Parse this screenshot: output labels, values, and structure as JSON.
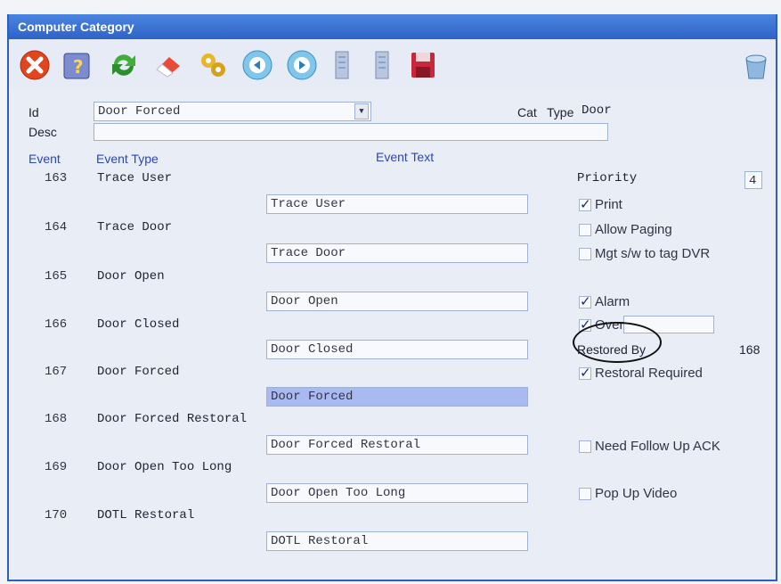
{
  "window": {
    "title": "Computer Category"
  },
  "toolbar": {
    "icons": [
      "close-icon",
      "help-icon",
      "refresh-icon",
      "eraser-icon",
      "gear-users-icon",
      "previous-icon",
      "next-icon",
      "document-icon",
      "document-alt-icon",
      "save-icon",
      "bucket-icon"
    ]
  },
  "form": {
    "id_label": "Id",
    "id_value": "Door Forced",
    "desc_label": "Desc",
    "desc_value": "",
    "cat_label": "Cat",
    "type_label": "Type",
    "type_value": "Door"
  },
  "columns": {
    "event": "Event",
    "event_type": "Event Type",
    "event_text": "Event Text"
  },
  "events": [
    {
      "num": "163",
      "type": "Trace User",
      "text": "Trace User"
    },
    {
      "num": "164",
      "type": "Trace Door",
      "text": "Trace Door"
    },
    {
      "num": "165",
      "type": "Door Open",
      "text": "Door Open"
    },
    {
      "num": "166",
      "type": "Door Closed",
      "text": "Door Closed"
    },
    {
      "num": "167",
      "type": "Door Forced",
      "text": "Door Forced"
    },
    {
      "num": "168",
      "type": "Door Forced Restoral",
      "text": "Door Forced Restoral"
    },
    {
      "num": "169",
      "type": "Door Open Too Long",
      "text": "Door Open Too Long"
    },
    {
      "num": "170",
      "type": "DOTL Restoral",
      "text": "DOTL Restoral"
    }
  ],
  "options": {
    "priority_label": "Priority",
    "priority_value": "4",
    "print": "Print",
    "allow_paging": "Allow Paging",
    "mgt": "Mgt s/w to tag DVR",
    "alarm": "Alarm",
    "override": "Override",
    "restored_by_label": "Restored By",
    "restored_by_value": "168",
    "restoral_required": "Restoral Required",
    "need_follow_up": "Need Follow Up ACK",
    "pop_up_video": "Pop Up Video"
  }
}
